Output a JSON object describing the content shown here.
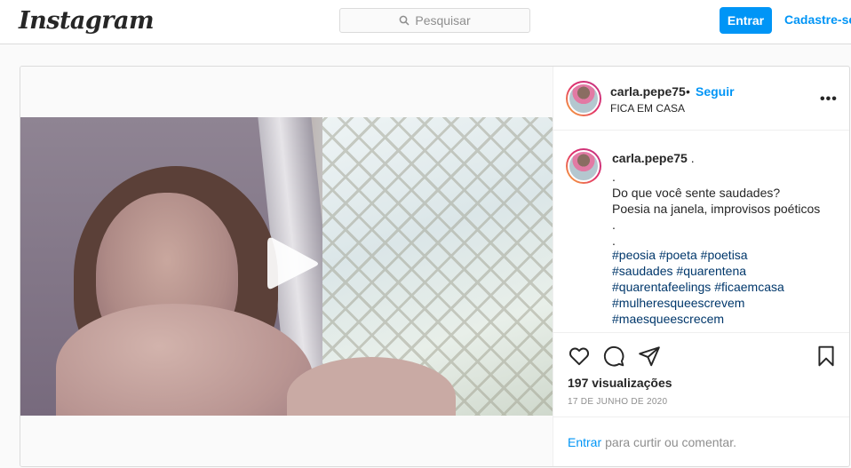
{
  "header": {
    "logo": "Instagram",
    "search_placeholder": "Pesquisar",
    "login_label": "Entrar",
    "signup_label": "Cadastre-se"
  },
  "post": {
    "username": "carla.pepe75",
    "separator": "•",
    "follow_label": "Seguir",
    "location": "FICA EM CASA",
    "more_icon": "more-options-icon",
    "caption": {
      "username": "carla.pepe75",
      "suffix": " .",
      "lines": [
        ".",
        "Do que você sente saudades?",
        "Poesia na janela, improvisos poéticos",
        ".",
        "."
      ],
      "hashtag_lines": [
        [
          "#peosia",
          "#poeta",
          "#poetisa"
        ],
        [
          "#saudades",
          "#quarentena"
        ],
        [
          "#quarentafeelings",
          "#ficaemcasa"
        ],
        [
          "#mulheresqueescrevem"
        ],
        [
          "#maesqueescrecem"
        ]
      ]
    },
    "actions": {
      "like_icon": "heart-icon",
      "comment_icon": "comment-icon",
      "share_icon": "share-icon",
      "save_icon": "bookmark-icon"
    },
    "views": "197 visualizações",
    "date": "17 DE JUNHO DE 2020",
    "comment_prompt_link": "Entrar",
    "comment_prompt_text": "para curtir ou comentar."
  },
  "colors": {
    "accent": "#0095f6",
    "hashtag": "#00376b",
    "border": "#dbdbdb"
  }
}
